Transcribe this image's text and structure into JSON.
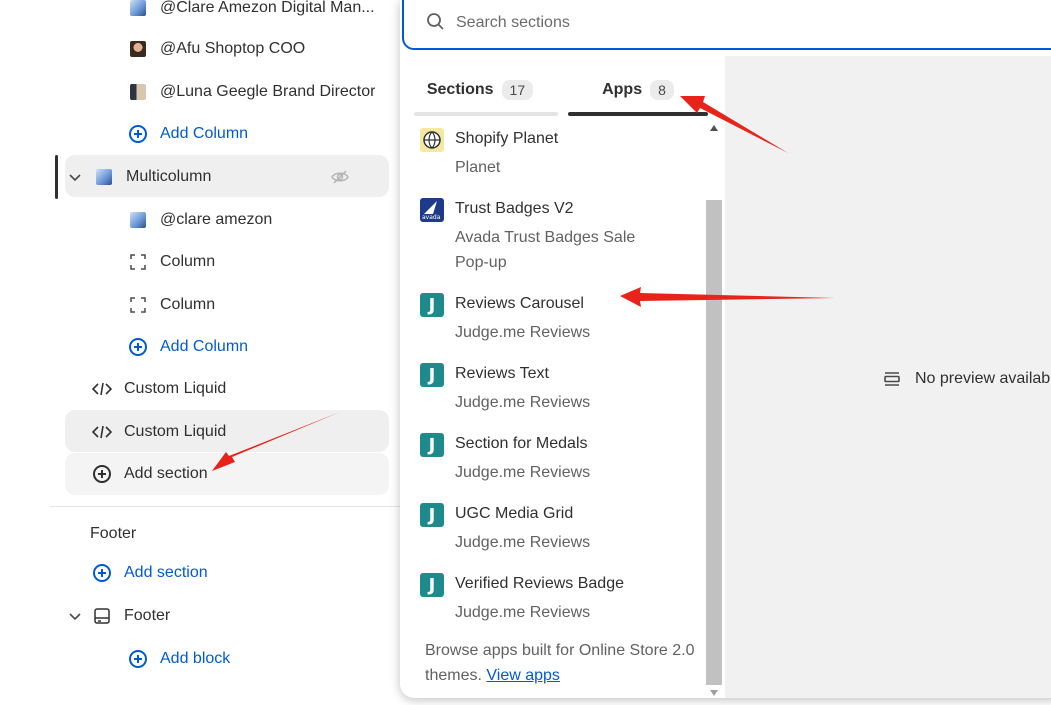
{
  "sidebar": {
    "items": [
      {
        "label": "@Clare Amezon Digital Man..."
      },
      {
        "label": "@Afu Shoptop COO"
      },
      {
        "label": "@Luna Geegle Brand Director"
      },
      {
        "label": "Add Column"
      },
      {
        "label": "Multicolumn"
      },
      {
        "label": "@clare amezon"
      },
      {
        "label": "Column"
      },
      {
        "label": "Column"
      },
      {
        "label": "Add Column"
      },
      {
        "label": "Custom Liquid"
      },
      {
        "label": "Custom Liquid"
      },
      {
        "label": "Add section"
      }
    ],
    "footer": {
      "heading": "Footer",
      "add_section": "Add section",
      "footer_label": "Footer",
      "add_block": "Add block"
    }
  },
  "popup": {
    "search_placeholder": "Search sections",
    "tabs": [
      {
        "label": "Sections",
        "count": "17"
      },
      {
        "label": "Apps",
        "count": "8"
      }
    ],
    "apps": [
      {
        "name": "Shopify Planet",
        "developer": "Planet"
      },
      {
        "name": "Trust Badges V2",
        "developer": "Avada Trust Badges Sale Pop-up",
        "logo_text": "avada"
      },
      {
        "name": "Reviews Carousel",
        "developer": "Judge.me Reviews"
      },
      {
        "name": "Reviews Text",
        "developer": "Judge.me Reviews"
      },
      {
        "name": "Section for Medals",
        "developer": "Judge.me Reviews"
      },
      {
        "name": "UGC Media Grid",
        "developer": "Judge.me Reviews"
      },
      {
        "name": "Verified Reviews Badge",
        "developer": "Judge.me Reviews"
      }
    ],
    "judge_logo_letter": "J",
    "browse_text": "Browse apps built for Online Store 2.0 themes.",
    "browse_link": "View apps",
    "preview_text": "No preview available"
  },
  "colors": {
    "accent": "#005bd3",
    "annotation_arrow": "#e8231a",
    "judge_logo": "#1f8a8c"
  }
}
